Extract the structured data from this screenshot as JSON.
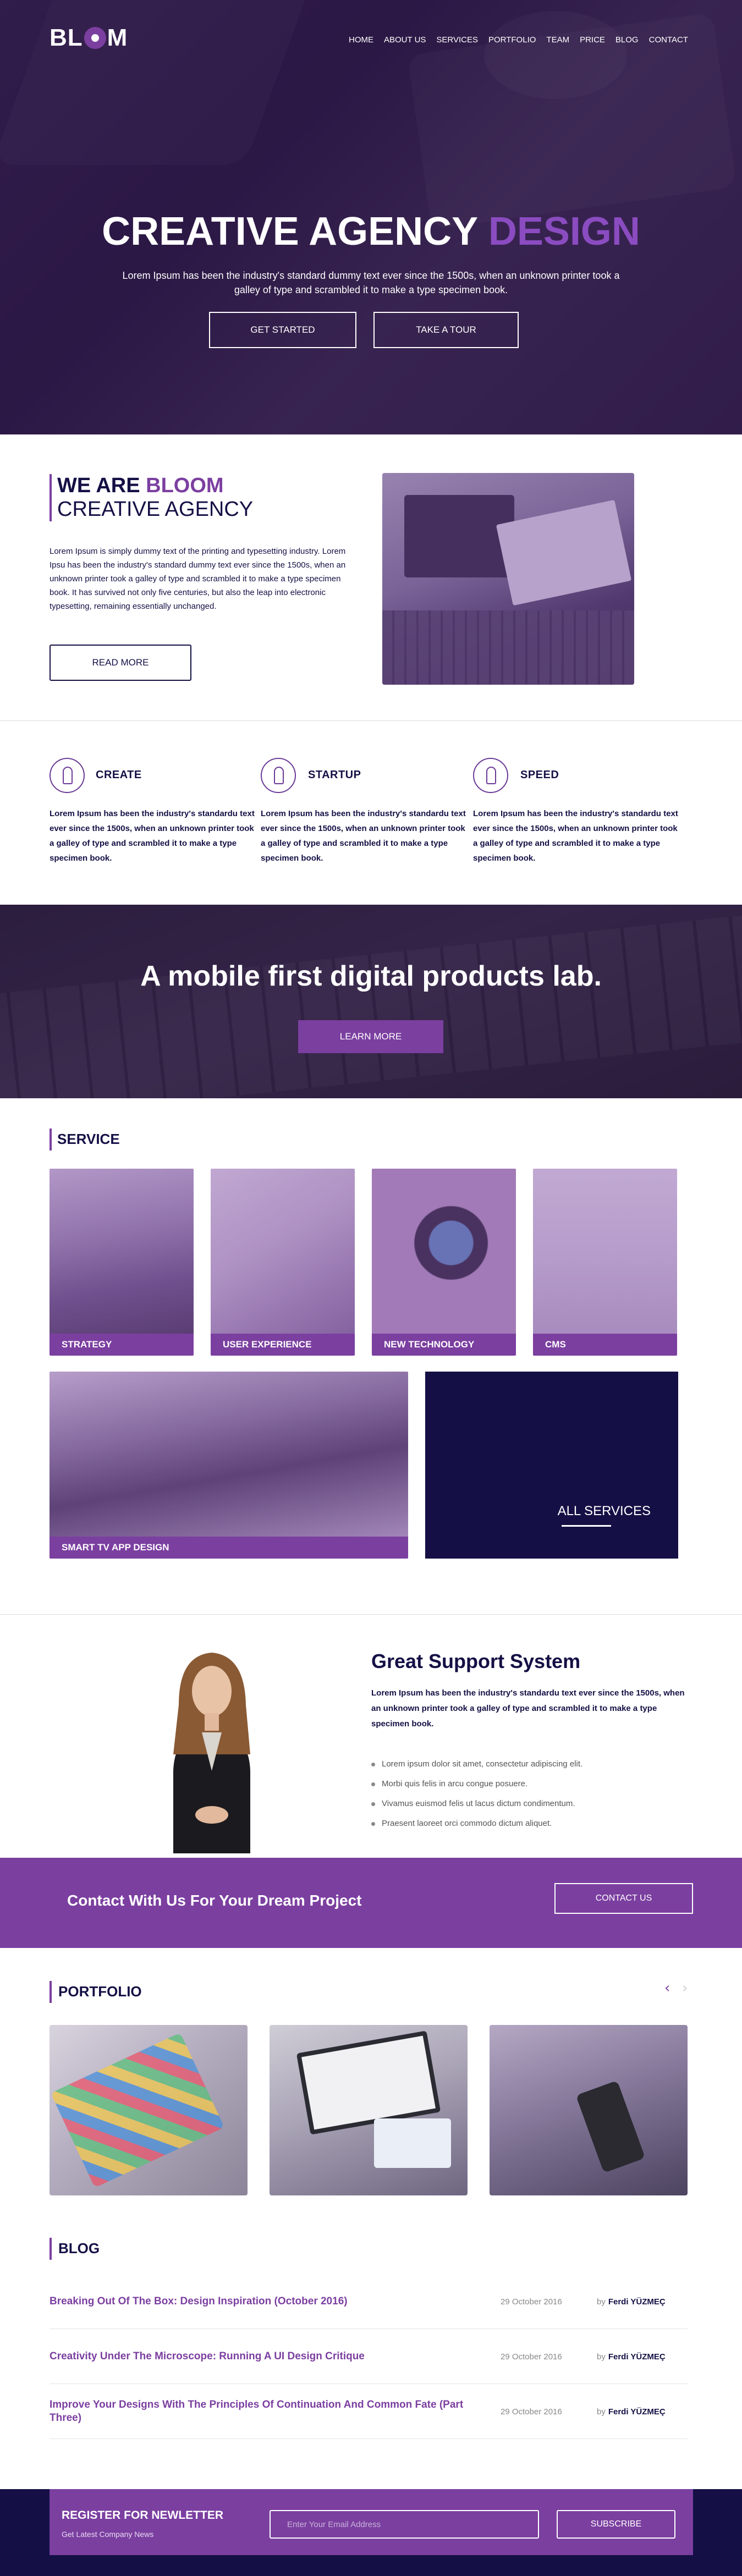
{
  "brand": {
    "logo_pre": "BL",
    "logo_post": "M"
  },
  "nav": [
    "HOME",
    "ABOUT US",
    "SERVICES",
    "PORTFOLIO",
    "TEAM",
    "PRICE",
    "BLOG",
    "CONTACT"
  ],
  "hero": {
    "title_main": "CREATIVE AGENCY ",
    "title_accent": "DESIGN",
    "subtitle": "Lorem Ipsum has been the industry's standard dummy text ever since the 1500s, when an unknown printer took a galley of type and scrambled it to make a type specimen book.",
    "btn_primary": "GET STARTED",
    "btn_secondary": "TAKE A TOUR"
  },
  "about": {
    "we_are": "WE ARE ",
    "brand": "BLOOM",
    "subtitle": "CREATIVE AGENCY",
    "text": "Lorem Ipsum is simply dummy text of the printing and typesetting industry. Lorem Ipsu has been the industry's standard dummy text ever since the 1500s, when an unknown printer took a galley of type and scrambled it to make a type specimen book. It has survived not only five centuries, but also the leap into electronic typesetting, remaining essentially unchanged.",
    "button": "READ MORE"
  },
  "features": [
    {
      "title": "CREATE",
      "icon": "robot-icon",
      "text": "Lorem Ipsum has been the industry's standardu text ever since the 1500s, when an unknown printer took a galley of type and scrambled it to make a type specimen book."
    },
    {
      "title": "STARTUP",
      "icon": "rocket-icon",
      "text": "Lorem Ipsum has been the industry's standardu text ever since the 1500s, when an unknown printer took a galley of type and scrambled it to make a type specimen book."
    },
    {
      "title": "SPEED",
      "icon": "speed-icon",
      "text": "Lorem Ipsum has been the industry's standardu text ever since the 1500s, when an unknown printer took a galley of type and scrambled it to make a type specimen book."
    }
  ],
  "banner": {
    "title": "A mobile first digital products lab.",
    "button": "LEARN MORE"
  },
  "service": {
    "heading": "SERVICE",
    "cards": [
      "STRATEGY",
      "USER EXPERIENCE",
      "NEW TECHNOLOGY",
      "CMS",
      "SMART TV APP DESIGN"
    ],
    "all_services": "ALL SERVICES"
  },
  "support": {
    "title": "Great Support System",
    "text": "Lorem Ipsum has been the industry's standardu text ever since the 1500s, when an unknown printer took a galley of type and scrambled it to make a type specimen book.",
    "bullets": [
      "Lorem ipsum dolor sit amet, consectetur adipiscing elit.",
      "Morbi quis felis in arcu congue posuere.",
      "Vivamus euismod felis ut lacus dictum condimentum.",
      "Praesent laoreet orci commodo dictum aliquet."
    ]
  },
  "contact": {
    "title": "Contact With Us For Your Dream Project",
    "button": "CONTACT US"
  },
  "portfolio": {
    "heading": "PORTFOLIO",
    "prev": "‹",
    "next": "›"
  },
  "blog": {
    "heading": "BLOG",
    "posts": [
      {
        "title": "Breaking Out Of The Box: Design Inspiration (October 2016)",
        "date": "29 October 2016",
        "by": "by",
        "author": "Ferdi YÜZMEÇ"
      },
      {
        "title": "Creativity Under The Microscope: Running A UI Design Critique",
        "date": "29 October 2016",
        "by": "by",
        "author": "Ferdi YÜZMEÇ"
      },
      {
        "title": "Improve Your Designs With The Principles Of Continuation And Common Fate (Part Three)",
        "date": "29 October 2016",
        "by": "by",
        "author": "Ferdi YÜZMEÇ"
      }
    ]
  },
  "newsletter": {
    "title": "REGISTER FOR NEWLETTER",
    "subtitle": "Get Latest Company News",
    "placeholder": "Enter Your Email Address",
    "button": "SUBSCRIBE"
  },
  "colors": {
    "accent": "#7b3fa0",
    "navy": "#141045",
    "white": "#ffffff"
  }
}
